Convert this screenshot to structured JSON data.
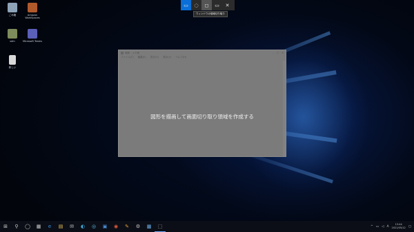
{
  "desktop": {
    "icons": [
      {
        "label": "ごみ箱",
        "color": "#8da3b8"
      },
      {
        "label": "Amazon\nWorkSpaces",
        "color": "#b05a2c"
      },
      {
        "label": "sdm",
        "color": "#7d8c5a"
      },
      {
        "label": "Microsoft Teams",
        "color": "#5a5fb8"
      },
      {
        "label": "新しい",
        "color": "#d9d9d9"
      }
    ]
  },
  "snip_toolbar": {
    "buttons": [
      {
        "name": "rectangle-snip",
        "glyph": "▭"
      },
      {
        "name": "freeform-snip",
        "glyph": "◌"
      },
      {
        "name": "window-snip",
        "glyph": "◻"
      },
      {
        "name": "fullscreen-snip",
        "glyph": "▭"
      },
      {
        "name": "close",
        "glyph": "✕"
      }
    ],
    "tooltip": "ウィンドウの領域切り取り"
  },
  "window": {
    "title": "無題 - メモ帳",
    "menu": [
      "ファイル(F)",
      "編集(E)",
      "書式(O)",
      "表示(V)",
      "ヘルプ(H)"
    ],
    "message": "図形を描画して画面切り取り領域を作成する"
  },
  "taskbar": {
    "start_glyph": "⊞",
    "items": [
      "⚲",
      "◯",
      "▦",
      "e",
      "▤",
      "✉",
      "◐",
      "◎",
      "▣",
      "◉",
      "✎",
      "⚙",
      "▩",
      "⬚"
    ],
    "tray": {
      "chevron": "^",
      "ime": "A",
      "time": "13:44",
      "date": "2021/05/12"
    }
  }
}
